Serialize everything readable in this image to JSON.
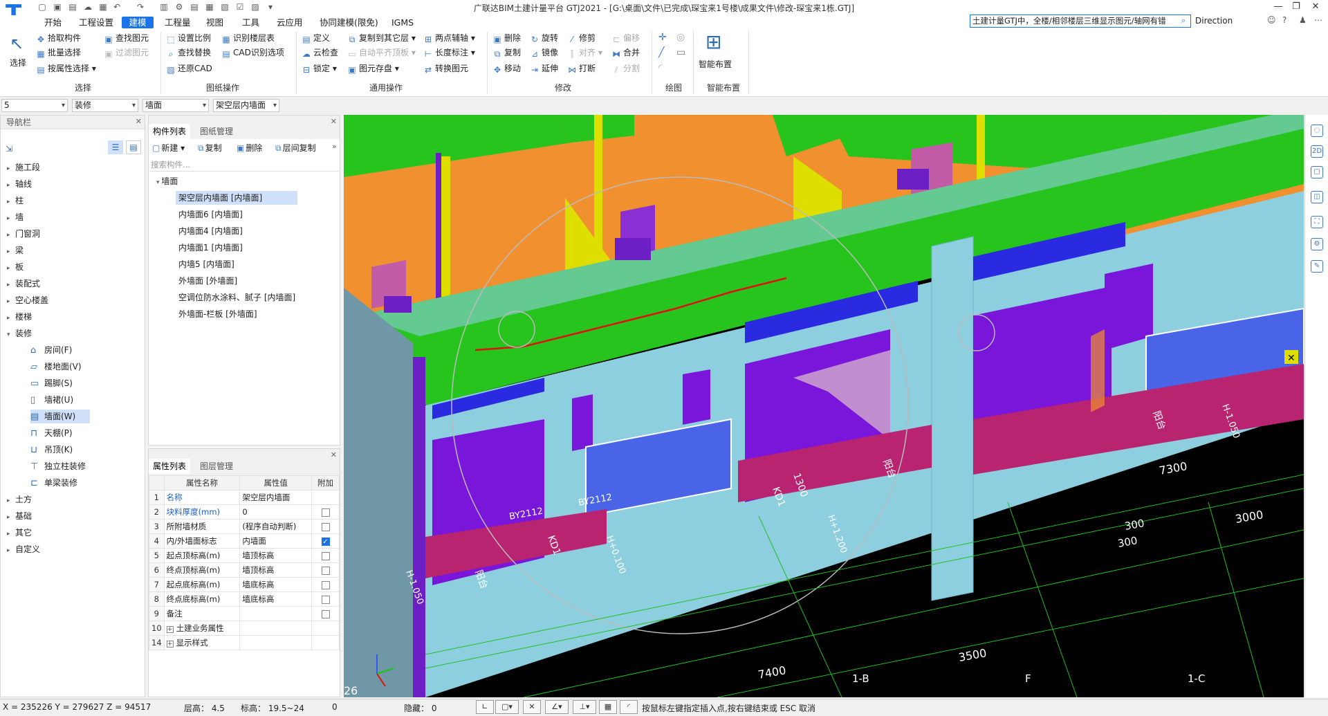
{
  "titlebar": {
    "title": "广联达BIM土建计量平台 GTJ2021 - [G:\\桌面\\文件\\已完成\\琛宝来1号楼\\成果文件\\修改-琛宝来1栋.GTJ]",
    "min": "—",
    "restore": "❐",
    "close": "✕"
  },
  "menu": {
    "items": [
      "开始",
      "工程设置",
      "建模",
      "工程量",
      "视图",
      "工具",
      "云应用",
      "协同建模(限免)",
      "IGMS"
    ],
    "active": "建模",
    "search_text": "土建计量GTJ中，全楼/相邻楼层三维显示图元/轴网有错",
    "direction_label": "Direction"
  },
  "ribbon": {
    "select_big": "选择",
    "select": [
      "拾取构件",
      "批量选择",
      "按属性选择"
    ],
    "find": [
      "查找图元",
      "过滤图元"
    ],
    "drawing_ops": [
      "设置比例",
      "查找替换",
      "还原CAD",
      "识别楼层表",
      "CAD识别选项"
    ],
    "general": [
      "定义",
      "云检查",
      "锁定",
      "复制到其它层",
      "自动平齐顶板",
      "图元存盘",
      "两点辅轴",
      "长度标注",
      "转换图元"
    ],
    "modify": [
      "删除",
      "复制",
      "移动",
      "旋转",
      "镜像",
      "延伸",
      "修剪",
      "对齐",
      "打断",
      "偏移",
      "合并",
      "分割"
    ],
    "smart_big": "智能布置",
    "groups": [
      "选择",
      "图纸操作",
      "通用操作",
      "修改",
      "绘图",
      "智能布置"
    ]
  },
  "filters": [
    "5",
    "装修",
    "墙面",
    "架空层内墙面"
  ],
  "nav": {
    "title": "导航栏",
    "items": [
      "施工段",
      "轴线",
      "柱",
      "墙",
      "门窗洞",
      "梁",
      "板",
      "装配式",
      "空心楼盖",
      "楼梯",
      "装修",
      "土方",
      "基础",
      "其它",
      "自定义"
    ],
    "subitems": [
      "房间(F)",
      "楼地面(V)",
      "踢脚(S)",
      "墙裙(U)",
      "墙面(W)",
      "天棚(P)",
      "吊顶(K)",
      "独立柱装修",
      "单梁装修"
    ],
    "selected_sub": "墙面(W)"
  },
  "components": {
    "tabs": [
      "构件列表",
      "图纸管理"
    ],
    "toolbar": [
      "新建",
      "复制",
      "删除",
      "层间复制"
    ],
    "search_placeholder": "搜索构件...",
    "root": "墙面",
    "items": [
      "架空层内墙面 [内墙面]",
      "内墙面6 [内墙面]",
      "内墙面4 [内墙面]",
      "内墙面1 [内墙面]",
      "内墙5 [内墙面]",
      "外墙面 [外墙面]",
      "空调位防水涂料、腻子 [内墙面]",
      "外墙面-栏板 [外墙面]"
    ],
    "selected": "架空层内墙面 [内墙面]"
  },
  "properties": {
    "tabs": [
      "属性列表",
      "图层管理"
    ],
    "headers": [
      "属性名称",
      "属性值",
      "附加"
    ],
    "rows": [
      {
        "n": "1",
        "name": "名称",
        "value": "架空层内墙面",
        "check": "none",
        "blue": true
      },
      {
        "n": "2",
        "name": "块料厚度(mm)",
        "value": "0",
        "check": "off",
        "blue": true
      },
      {
        "n": "3",
        "name": "所附墙材质",
        "value": "(程序自动判断)",
        "check": "off",
        "blue": false
      },
      {
        "n": "4",
        "name": "内/外墙面标志",
        "value": "内墙面",
        "check": "on",
        "blue": false
      },
      {
        "n": "5",
        "name": "起点顶标高(m)",
        "value": "墙顶标高",
        "check": "off",
        "blue": false
      },
      {
        "n": "6",
        "name": "终点顶标高(m)",
        "value": "墙顶标高",
        "check": "off",
        "blue": false
      },
      {
        "n": "7",
        "name": "起点底标高(m)",
        "value": "墙底标高",
        "check": "off",
        "blue": false
      },
      {
        "n": "8",
        "name": "终点底标高(m)",
        "value": "墙底标高",
        "check": "off",
        "blue": false
      },
      {
        "n": "9",
        "name": "备注",
        "value": "",
        "check": "off",
        "blue": false
      },
      {
        "n": "10",
        "name": "土建业务属性",
        "value": "",
        "check": "none",
        "blue": false,
        "group": true
      },
      {
        "n": "14",
        "name": "显示样式",
        "value": "",
        "check": "none",
        "blue": false,
        "group": true
      }
    ]
  },
  "viewport": {
    "floor_number": "26",
    "dims": [
      "7300",
      "3000",
      "3500",
      "7400",
      "300",
      "300"
    ],
    "axis_labels": [
      "1-B",
      "F",
      "1-C"
    ],
    "room_labels": [
      "阳台",
      "阳台",
      "阳台",
      "KD1",
      "KD1",
      "1300"
    ],
    "codes": [
      "H-1.050",
      "H-1.050",
      "H+1.200",
      "H+0.100",
      "BY2112",
      "BY2112"
    ],
    "colors": {
      "orange": "#f0902f",
      "green": "#27c41e",
      "lightblue": "#8ecfdf",
      "purple": "#6b1fc4",
      "magenta": "#b8246f",
      "window": "#4a64e8",
      "yellow": "#dede00"
    }
  },
  "statusbar": {
    "coords": "X = 235226 Y = 279627 Z = 94517",
    "floor_height": "层高：  4.5",
    "elevation": "标高：  19.5~24",
    "zero": "0",
    "hidden": "隐藏：  0",
    "hint": "按鼠标左键指定插入点,按右键结束或 ESC 取消"
  }
}
